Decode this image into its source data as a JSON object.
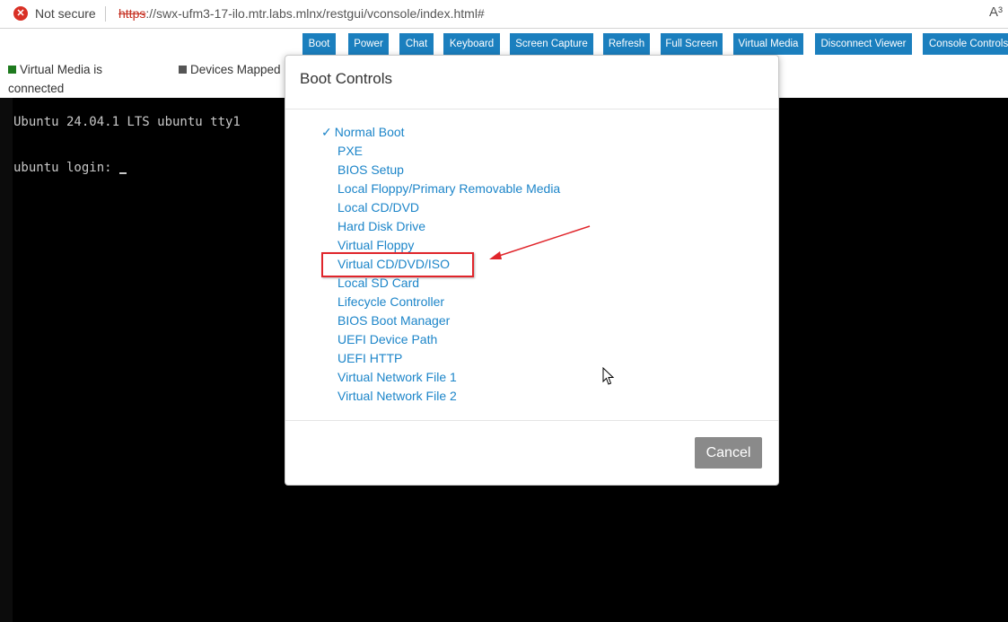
{
  "browser": {
    "security_text": "Not secure",
    "url_proto": "https",
    "url_rest": "://swx-ufm3-17-ilo.mtr.labs.mlnx/restgui/vconsole/index.html#",
    "read_aloud_label": "A³"
  },
  "toolbar": {
    "buttons": [
      {
        "label": "Boot"
      },
      {
        "label": "Power"
      },
      {
        "label": "Chat"
      },
      {
        "label": "Keyboard"
      },
      {
        "label": "Screen Capture"
      },
      {
        "label": "Refresh"
      },
      {
        "label": "Full Screen"
      },
      {
        "label": "Virtual Media"
      },
      {
        "label": "Disconnect Viewer"
      },
      {
        "label": "Console Controls"
      }
    ]
  },
  "status": {
    "virtual_media": "Virtual Media is connected",
    "virtual_media_line1": "Virtual Media is",
    "virtual_media_line2": "connected",
    "devices": "Devices Mapped"
  },
  "colors": {
    "connected": "#1e7a1e",
    "devices": "#555555",
    "accent": "#1b7fbe",
    "highlight": "#e0252b"
  },
  "console": {
    "line1": "Ubuntu 24.04.1 LTS ubuntu tty1",
    "line2": "ubuntu login: "
  },
  "modal": {
    "title": "Boot Controls",
    "check_mark": "✓",
    "selected_index": 0,
    "highlighted_item": "Virtual CD/DVD/ISO",
    "items": [
      "Normal Boot",
      "PXE",
      "BIOS Setup",
      "Local Floppy/Primary Removable Media",
      "Local CD/DVD",
      "Hard Disk Drive",
      "Virtual Floppy",
      "Virtual CD/DVD/ISO",
      "Local SD Card",
      "Lifecycle Controller",
      "BIOS Boot Manager",
      "UEFI Device Path",
      "UEFI HTTP",
      "Virtual Network File 1",
      "Virtual Network File 2"
    ],
    "cancel_label": "Cancel"
  }
}
